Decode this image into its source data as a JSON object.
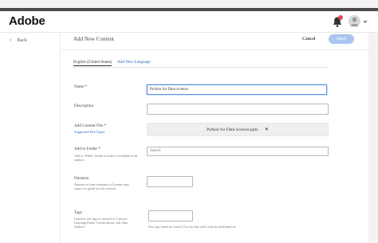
{
  "header": {
    "logo": "Adobe",
    "bell_icon": "bell-icon",
    "avatar_icon": "user-avatar-icon",
    "caret_icon": "chevron-down-icon"
  },
  "nav": {
    "back_label": "Back",
    "back_icon": "chevron-left-icon"
  },
  "page": {
    "title": "Add New Content",
    "cancel_label": "Cancel",
    "save_label": "Save"
  },
  "tabs": [
    {
      "label": "English (United States)",
      "active": true
    },
    {
      "label": "Add New Language",
      "active": false
    }
  ],
  "form": {
    "name": {
      "label": "Name *",
      "value": "Python for Data science"
    },
    "description": {
      "label": "Description",
      "value": ""
    },
    "content_file": {
      "label": "Add Content File *",
      "link": "Supported File Types",
      "file_name": "Python for Data Science.pptx",
      "remove_icon": "close-icon"
    },
    "folder": {
      "label": "Add to Folder *",
      "hint": "Add to 'Public' folder to make it available to all authors.",
      "placeholder": "Search"
    },
    "duration": {
      "label": "Duration",
      "hint": "Amount of time (minutes) a Learner may expect to spend on this content.",
      "value": ""
    },
    "tags": {
      "label": "Tags",
      "hint": "Learners use tags to search for Courses/ Learning Paths/ Certifications/ Job Aids. Authors",
      "value": "",
      "note": "New tags cannot be created. You can only select from the predefined set."
    }
  },
  "colors": {
    "accent": "#2a64c5",
    "save_disabled": "#a8c6f0",
    "header_bar": "#4b4b4b"
  }
}
